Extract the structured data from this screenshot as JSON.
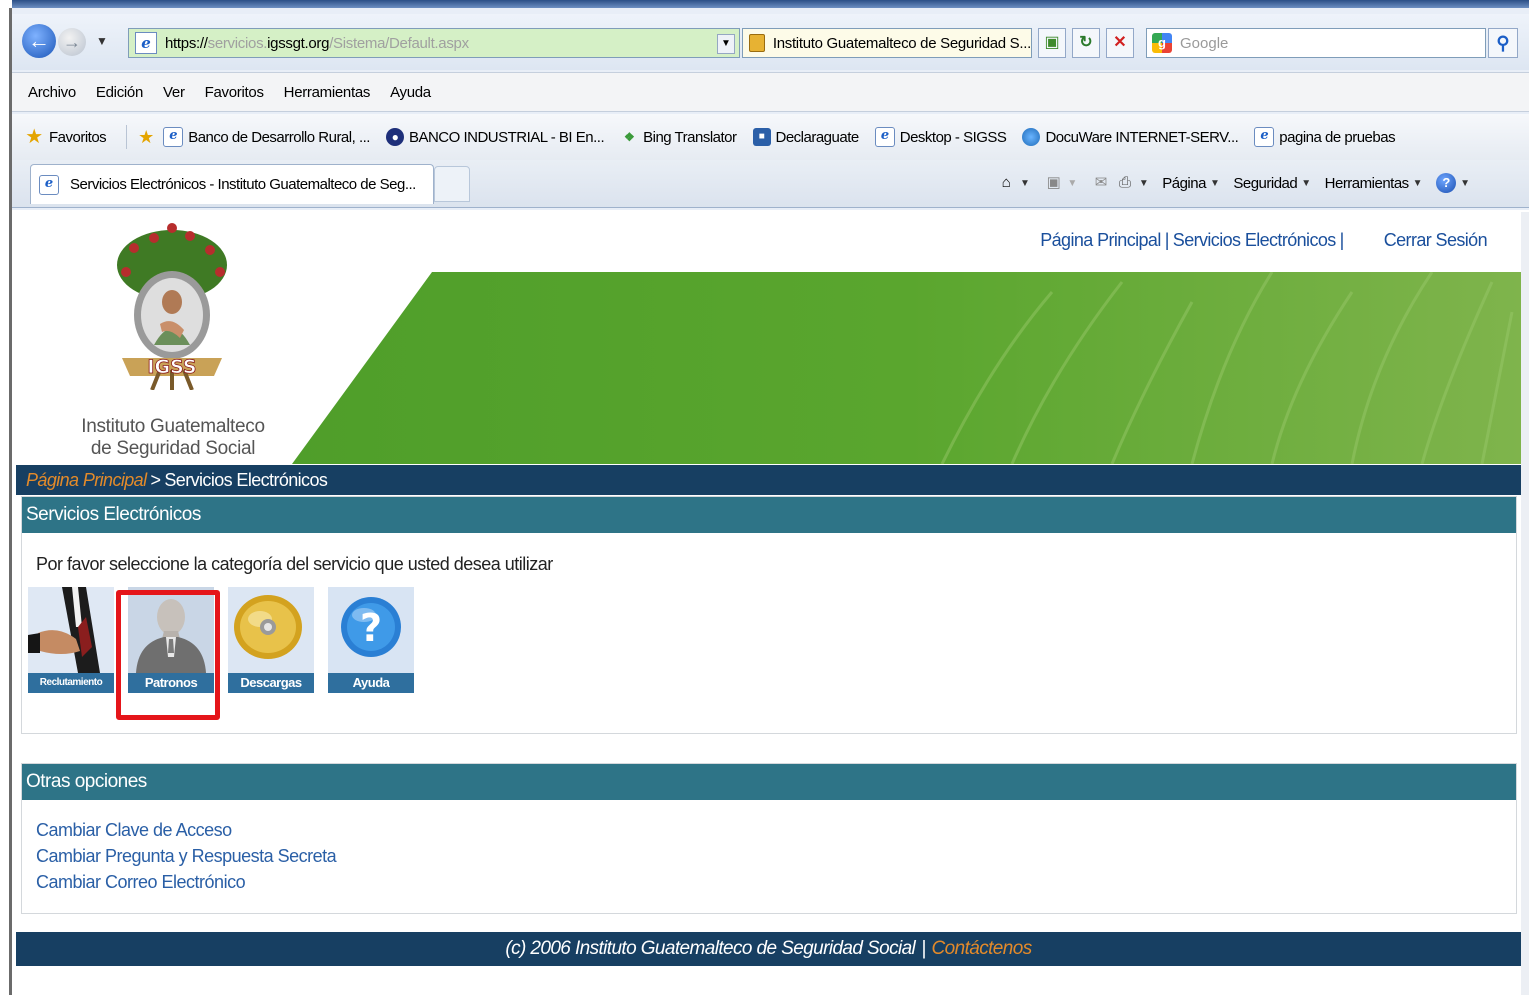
{
  "browser": {
    "url": {
      "protocol": "https://",
      "subdomain": "servicios.",
      "domain": "igssgt.org",
      "path": "/Sistema/Default.aspx"
    },
    "site_identity": "Instituto Guatemalteco de Seguridad S...",
    "search_placeholder": "Google",
    "menu": [
      "Archivo",
      "Edición",
      "Ver",
      "Favoritos",
      "Herramientas",
      "Ayuda"
    ],
    "favorites_label": "Favoritos",
    "favorites": [
      {
        "label": "Banco de Desarrollo Rural, ...",
        "icon": "ie-page-icon"
      },
      {
        "label": "BANCO INDUSTRIAL - BI En...",
        "icon": "bi-icon"
      },
      {
        "label": "Bing Translator",
        "icon": "bing-translator-icon"
      },
      {
        "label": "Declaraguate",
        "icon": "declaraguate-icon"
      },
      {
        "label": "Desktop - SIGSS",
        "icon": "ie-page-icon"
      },
      {
        "label": "DocuWare INTERNET-SERV...",
        "icon": "docuware-icon"
      },
      {
        "label": "pagina de pruebas",
        "icon": "ie-page-icon"
      }
    ],
    "tab_title": "Servicios Electrónicos - Instituto Guatemalteco de Seg...",
    "command_bar": {
      "page": "Página",
      "security": "Seguridad",
      "tools": "Herramientas"
    }
  },
  "page": {
    "top_links": {
      "home": "Página Principal",
      "services": "Servicios Electrónicos",
      "separator": "|",
      "logout": "Cerrar Sesión"
    },
    "logo": {
      "badge_text": "IGSS",
      "caption_line1": "Instituto Guatemalteco",
      "caption_line2": "de Seguridad Social"
    },
    "breadcrumb": {
      "home": "Página Principal",
      "separator": ">",
      "current": "Servicios Electrónicos"
    },
    "services_section": {
      "title": "Servicios Electrónicos",
      "intro": "Por favor seleccione la categoría del servicio que usted desea utilizar",
      "tiles": [
        {
          "label": "Reclutamiento",
          "icon": "handshake-icon"
        },
        {
          "label": "Patronos",
          "icon": "employer-person-icon",
          "highlighted": true
        },
        {
          "label": "Descargas",
          "icon": "cd-disc-icon"
        },
        {
          "label": "Ayuda",
          "icon": "help-question-icon"
        }
      ]
    },
    "other_options": {
      "title": "Otras opciones",
      "links": [
        "Cambiar Clave de Acceso",
        "Cambiar Pregunta y Respuesta Secreta",
        "Cambiar Correo Electrónico"
      ]
    },
    "footer": {
      "copyright": "(c) 2006 Instituto Guatemalteco de Seguridad Social",
      "separator": "|",
      "contact": "Contáctenos"
    }
  },
  "colors": {
    "nav_bar": "#173f62",
    "section_header": "#2e7487",
    "link": "#1a4f9c",
    "accent_orange": "#e38a2a",
    "highlight_red": "#e5151a",
    "banner_green": "#5aa62e"
  }
}
